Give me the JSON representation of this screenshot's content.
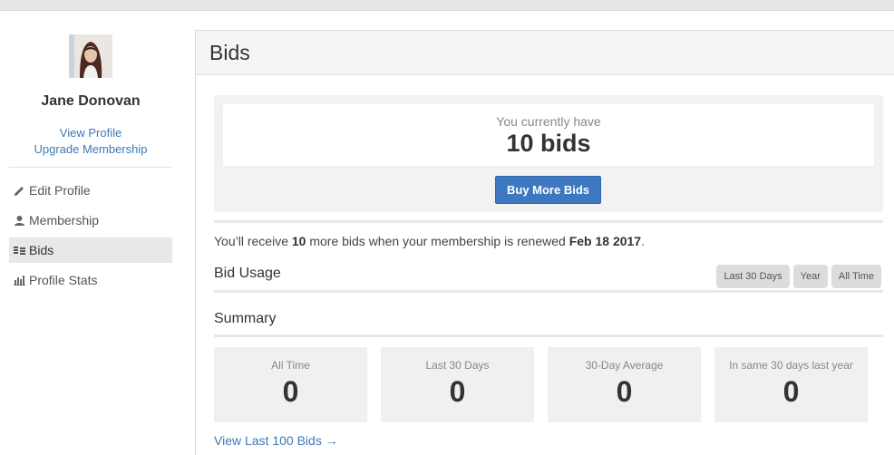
{
  "user": {
    "name": "Jane Donovan"
  },
  "profile_links": {
    "view": "View Profile",
    "upgrade": "Upgrade Membership"
  },
  "nav": [
    {
      "label": "Edit Profile",
      "icon": "pencil-icon"
    },
    {
      "label": "Membership",
      "icon": "user-icon"
    },
    {
      "label": "Bids",
      "icon": "bids-icon",
      "active": true
    },
    {
      "label": "Profile Stats",
      "icon": "bar-chart-icon"
    }
  ],
  "panel": {
    "title": "Bids"
  },
  "bids": {
    "caption": "You currently have",
    "count": "10 bids",
    "buy_button": "Buy More Bids"
  },
  "renewal": {
    "prefix": "You’ll receive ",
    "amount": "10",
    "middle": " more bids when your membership is renewed ",
    "date": "Feb 18 2017",
    "suffix": "."
  },
  "usage": {
    "title": "Bid Usage",
    "filters": [
      "Last 30 Days",
      "Year",
      "All Time"
    ]
  },
  "summary": {
    "title": "Summary",
    "stats": [
      {
        "label": "All Time",
        "value": "0"
      },
      {
        "label": "Last 30 Days",
        "value": "0"
      },
      {
        "label": "30-Day Average",
        "value": "0"
      },
      {
        "label": "In same 30 days last year",
        "value": "0"
      }
    ]
  },
  "view_last_link": "View Last 100 Bids →",
  "colors": {
    "accent": "#3d78c0",
    "link": "#3e78b8",
    "active_nav_bg": "#e8e8e8"
  }
}
